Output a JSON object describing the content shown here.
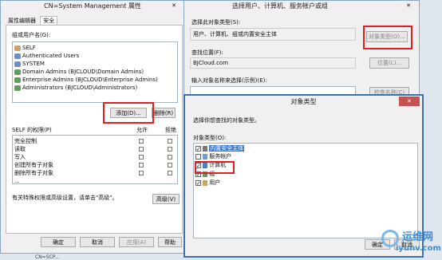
{
  "left_dialog": {
    "title": "CN=System Management 属性",
    "tabs": [
      "属性编辑器",
      "安全"
    ],
    "group_label": "组或用户名(G):",
    "users": [
      "SELF",
      "Authenticated Users",
      "SYSTEM",
      "Domain Admins (BJCLOUD\\Domain Admins)",
      "Enterprise Admins (BJCLOUD\\Enterprise Admins)",
      "Administrators (BJCLOUD\\Administrators)"
    ],
    "add_button": "添加(D)...",
    "remove_button": "删除(R)",
    "perm_label": "SELF 的权限(P)",
    "allow_col": "允许",
    "deny_col": "拒绝",
    "permissions": [
      "完全控制",
      "读取",
      "写入",
      "创建所有子对象",
      "删除所有子对象",
      "..."
    ],
    "advanced_hint": "有关特殊权限或高级设置，请单击\"高级\"。",
    "advanced_button": "高级(V)",
    "ok": "确定",
    "cancel": "取消",
    "apply": "应用(A)",
    "help": "帮助"
  },
  "select_dialog": {
    "title": "选择用户、计算机、服务帐户或组",
    "object_type_label": "选择此对象类型(S):",
    "object_type_value": "用户、计算机、组或内置安全主体",
    "object_types_button": "对象类型(O)...",
    "location_label": "查找位置(F):",
    "location_value": "BJCloud.com",
    "location_button": "位置(L)...",
    "enter_label": "输入对象名称来选择(示例)(E):",
    "check_button": "检查名称(C)"
  },
  "object_types_dialog": {
    "title": "对象类型",
    "instruction": "选择你想查找的对象类型。",
    "types_label": "对象类型(O):",
    "items": [
      {
        "label": "内置安全主体",
        "checked": true,
        "selected": true
      },
      {
        "label": "服务帐户",
        "checked": false,
        "selected": false
      },
      {
        "label": "计算机",
        "checked": true,
        "selected": false
      },
      {
        "label": "组",
        "checked": true,
        "selected": false
      },
      {
        "label": "用户",
        "checked": true,
        "selected": false
      }
    ],
    "ok": "确定",
    "cancel": "取消"
  },
  "watermark": {
    "cn": "运维网",
    "url": "iyunv.com"
  },
  "background_item": "CN=SCP..."
}
